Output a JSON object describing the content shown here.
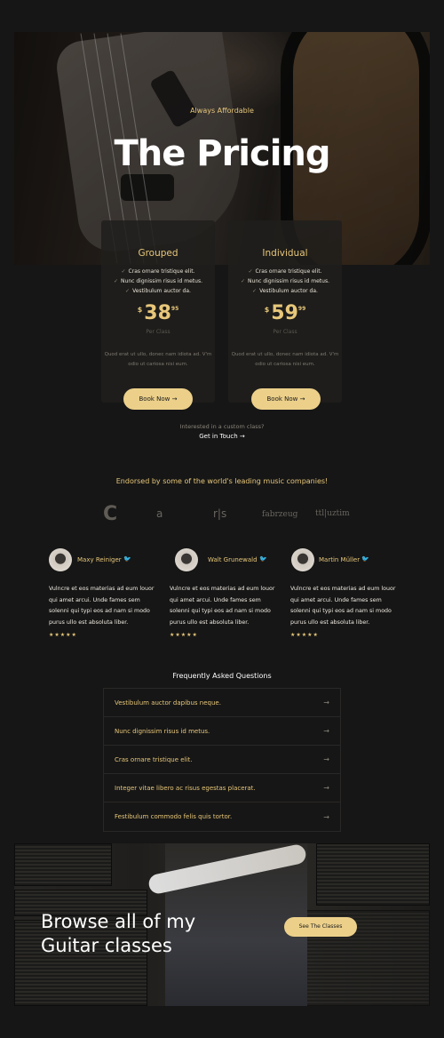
{
  "hero": {
    "subtitle": "Always Affordable",
    "title": "The Pricing"
  },
  "plans": [
    {
      "name": "Grouped",
      "features": [
        "Cras ornare tristique elit.",
        "Nunc dignissim risus id metus.",
        "Vestibulum auctor da."
      ],
      "currency": "$",
      "price": "38",
      "cents": "95",
      "per": "Per Class",
      "description": "Quod erat ut ullo, donec nam idiota ad. V'm odio ut cariosa nisi eum.",
      "button": "Book Now"
    },
    {
      "name": "Individual",
      "features": [
        "Cras ornare tristique elit.",
        "Nunc dignissim risus id metus.",
        "Vestibulum auctor da."
      ],
      "currency": "$",
      "price": "59",
      "cents": "99",
      "per": "Per Class",
      "description": "Quod erat ut ullo, donec nam idiota ad. V'm odio ut cariosa nisi eum.",
      "button": "Book Now"
    }
  ],
  "custom": {
    "question": "Interested in a custom class?",
    "link": "Get in Touch"
  },
  "endorsed": {
    "title": "Endorsed by some of the world's leading music companies!",
    "logos": [
      "C",
      "a",
      "r|s",
      "fabrzeug",
      "ttl|uztim"
    ]
  },
  "testimonials": [
    {
      "name": "Maxy Reiniger",
      "quote": "Vulncre et eos materias ad eum louor qui amet arcui. Unde fames sem solenni qui typi eos ad nam si modo purus ullo est absoluta liber.",
      "stars": "★★★★★"
    },
    {
      "name": "Walt Grunewald",
      "quote": "Vulncre et eos materias ad eum louor qui amet arcui. Unde fames sem solenni qui typi eos ad nam si modo purus ullo est absoluta liber.",
      "stars": "★★★★★"
    },
    {
      "name": "Martin Müller",
      "quote": "Vulncre et eos materias ad eum louor qui amet arcui. Unde fames sem solenni qui typi eos ad nam si modo purus ullo est absoluta liber.",
      "stars": "★★★★★"
    }
  ],
  "faq": {
    "title": "Frequently Asked Questions",
    "items": [
      "Vestibulum auctor dapibus neque.",
      "Nunc dignissim risus id metus.",
      "Cras ornare tristique elit.",
      "Integer vitae libero ac risus egestas placerat.",
      "Festibulum commodo felis quis tortor."
    ]
  },
  "banner": {
    "line1": "Browse all of my",
    "line2": "Guitar classes",
    "button": "See The Classes"
  },
  "icons": {
    "check": "✓",
    "arrow": "→",
    "twitter": "🐦"
  },
  "colors": {
    "accent": "#e7c77a",
    "button": "#ecd08a",
    "background": "#161616"
  }
}
